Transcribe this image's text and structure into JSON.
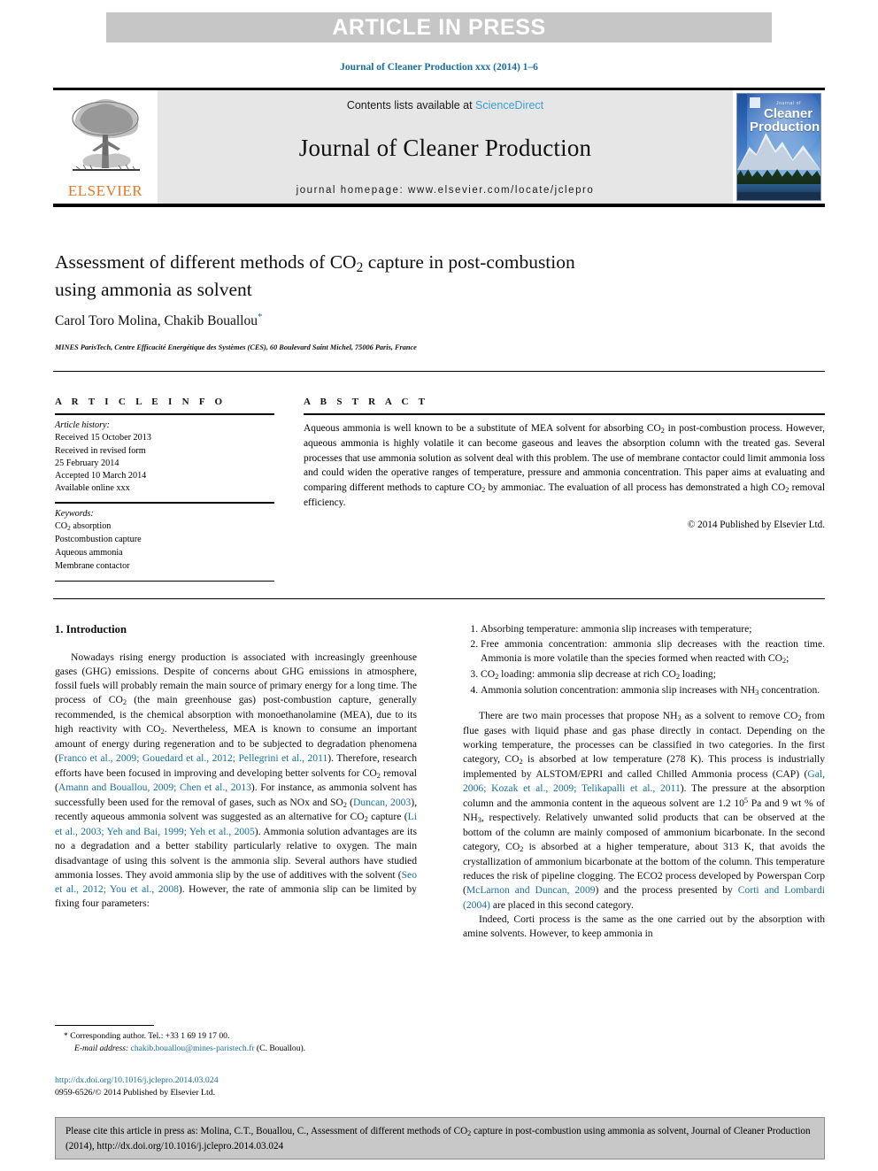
{
  "banner": {
    "label": "ARTICLE IN PRESS"
  },
  "running_head": "Journal of Cleaner Production xxx (2014) 1–6",
  "masthead": {
    "contents_prefix": "Contents lists available at ",
    "sciencedirect": "ScienceDirect",
    "journal_name": "Journal of Cleaner Production",
    "homepage": "journal homepage: www.elsevier.com/locate/jclepro",
    "publisher_logo": "ELSEVIER",
    "cover": {
      "small_top": "Journal of",
      "line1": "Cleaner",
      "line2": "Production"
    }
  },
  "article": {
    "title_line1": "Assessment of different methods of CO",
    "title_sub1": "2",
    "title_line1b": " capture in post-combustion",
    "title_line2": "using ammonia as solvent",
    "authors": "Carol Toro Molina, Chakib Bouallou",
    "author_star": "*",
    "affiliation": "MINES ParisTech, Centre Efficacité Energétique des Systèmes (CES), 60 Boulevard Saint Michel, 75006 Paris, France"
  },
  "info": {
    "heading": "A R T I C L E   I N F O",
    "history_label": "Article history:",
    "history": [
      "Received 15 October 2013",
      "Received in revised form",
      "25 February 2014",
      "Accepted 10 March 2014",
      "Available online xxx"
    ],
    "keywords_label": "Keywords:",
    "keywords_line1a": "CO",
    "keywords_line1sub": "2",
    "keywords_line1b": " absorption",
    "keywords_rest": [
      "Postcombustion capture",
      "Aqueous ammonia",
      "Membrane contactor"
    ]
  },
  "abstract": {
    "heading": "A B S T R A C T",
    "p1a": "Aqueous ammonia is well known to be a substitute of MEA solvent for absorbing CO",
    "p1sub1": "2",
    "p1b": " in post-combustion process. However, aqueous ammonia is highly volatile it can become gaseous and leaves the absorption column with the treated gas. Several processes that use ammonia solution as solvent deal with this problem. The use of membrane contactor could limit ammonia loss and could widen the operative ranges of temperature, pressure and ammonia concentration. This paper aims at evaluating and comparing different methods to capture CO",
    "p1sub2": "2",
    "p1c": " by ammoniac. The evaluation of all process has demonstrated a high CO",
    "p1sub3": "2",
    "p1d": " removal efficiency.",
    "copyright": "© 2014 Published by Elsevier Ltd."
  },
  "intro": {
    "heading": "1.  Introduction",
    "p1_a": "Nowadays rising energy production is associated with increasingly greenhouse gases (GHG) emissions. Despite of concerns about GHG emissions in atmosphere, fossil fuels will probably remain the main source of primary energy for a long time. The process of CO",
    "p1_sub1": "2",
    "p1_b": " (the main greenhouse gas) post-combustion capture, generally recommended, is the chemical absorption with monoethanolamine (MEA), due to its high reactivity with CO",
    "p1_sub2": "2",
    "p1_c": ". Nevertheless, MEA is known to consume an important amount of energy during regeneration and to be subjected to degradation phenomena (",
    "ref1": "Franco et al., 2009; Gouedard et al., 2012; Pellegrini et al., 2011",
    "p1_d": "). Therefore, research efforts have been focused in improving and developing better solvents for CO",
    "p1_sub3": "2",
    "p1_e": " removal (",
    "ref2": "Amann and Bouallou, 2009; Chen et al., 2013",
    "p1_f": "). For instance, as ammonia solvent has successfully been used for the removal of gases, such as NOx and SO",
    "p1_sub4": "2",
    "p1_g": " (",
    "ref3": "Duncan, 2003",
    "p1_h": "), recently aqueous ammonia solvent was suggested as an alternative for CO",
    "p1_sub5": "2",
    "p1_i": " capture (",
    "ref4": "Li et al., 2003; Yeh and Bai, 1999; Yeh et al., 2005",
    "p1_j": "). Ammonia solution advantages are its no a degradation and a better stability particularly relative to oxygen. The main disadvantage of using this solvent is the ammonia slip. Several authors have studied ammonia losses. They avoid ammonia slip by the use of additives with the solvent (",
    "ref5": "Seo et al., 2012; You et al., 2008",
    "p1_k": "). However, the rate of ammonia slip can be limited by fixing four parameters:"
  },
  "list": {
    "items": [
      {
        "n": "1.",
        "a": "Absorbing temperature: ammonia slip increases with temperature;"
      },
      {
        "n": "2.",
        "a": "Free ammonia concentration: ammonia slip decreases with the reaction time. Ammonia is more volatile than the species formed when reacted with CO",
        "sub": "2",
        "b": ";"
      },
      {
        "n": "3.",
        "a": "CO",
        "sub": "2",
        "b": " loading: ammonia slip decrease at rich CO",
        "sub2": "2",
        "c": " loading;"
      },
      {
        "n": "4.",
        "a": "Ammonia solution concentration: ammonia slip increases with NH",
        "sub": "3",
        "b": " concentration."
      }
    ]
  },
  "right_text": {
    "p2_a": "There are two main processes that propose NH",
    "p2_sub1": "3",
    "p2_b": " as a solvent to remove CO",
    "p2_sub2": "2",
    "p2_c": " from flue gases with liquid phase and gas phase directly in contact. Depending on the working temperature, the processes can be classified in two categories. In the first category, CO",
    "p2_sub3": "2",
    "p2_d": " is absorbed at low temperature (278 K). This process is industrially implemented by ALSTOM/EPRI and called Chilled Ammonia process (CAP) (",
    "ref6": "Gal, 2006; Kozak et al., 2009; Telikapalli et al., 2011",
    "p2_e": "). The pressure at the absorption column and the ammonia content in the aqueous solvent are 1.2 10",
    "p2_sup1": "5",
    "p2_f": " Pa and 9 wt % of NH",
    "p2_sub4": "3",
    "p2_g": ", respectively. Relatively unwanted solid products that can be observed at the bottom of the column are mainly composed of ammonium bicarbonate. In the second category, CO",
    "p2_sub5": "2",
    "p2_h": " is absorbed at a higher temperature, about 313 K, that avoids the crystallization of ammonium bicarbonate at the bottom of the column. This temperature reduces the risk of pipeline clogging. The ECO2 process developed by Powerspan Corp (",
    "ref7": "McLarnon and Duncan, 2009",
    "p2_i": ") and the process presented by ",
    "ref8": "Corti and Lombardi (2004)",
    "p2_j": " are placed in this second category.",
    "p3": "Indeed, Corti process is the same as the one carried out by the absorption with amine solvents. However, to keep ammonia in"
  },
  "footnote": {
    "star": "*",
    "corresponding": "Corresponding author. Tel.: +33 1 69 19 17 00.",
    "email_label": "E-mail address:",
    "email": "chakib.bouallou@mines-paristech.fr",
    "email_suffix": "(C. Bouallou)."
  },
  "doi_block": {
    "doi": "http://dx.doi.org/10.1016/j.jclepro.2014.03.024",
    "issn_line": "0959-6526/© 2014 Published by Elsevier Ltd."
  },
  "cite_box": {
    "text_a": "Please cite this article in press as: Molina, C.T., Bouallou, C., Assessment of different methods of CO",
    "sub": "2",
    "text_b": " capture in post-combustion using ammonia as solvent, Journal of Cleaner Production (2014), http://dx.doi.org/10.1016/j.jclepro.2014.03.024"
  },
  "colors": {
    "link": "#176f9c",
    "sciencedirect": "#3a9fd4",
    "banner_bg": "#c6c6c6",
    "masthead_bg": "#e6e6e6",
    "cite_bg": "#c8c8c8",
    "elsevier_orange": "#e87722"
  }
}
